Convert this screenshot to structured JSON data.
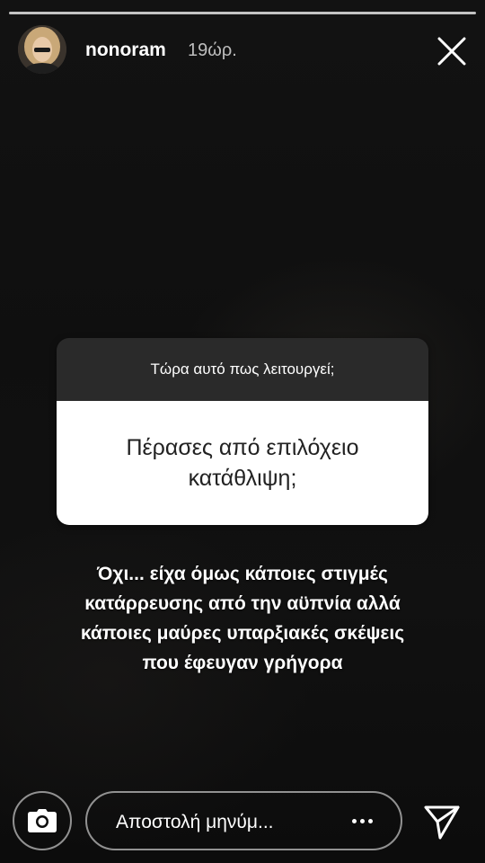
{
  "header": {
    "username": "nonoram",
    "time": "19ώρ."
  },
  "question": {
    "title": "Τώρα αυτό πως λειτουργεί;",
    "text": "Πέρασες από επιλόχειο κατάθλιψη;"
  },
  "answer": {
    "lines": [
      "Όχι... είχα όμως κάποιες στιγμές",
      "κατάρρευσης από την αϋπνία αλλά",
      "κάποιες μαύρες υπαρξιακές σκέψεις",
      "που έφευγαν γρήγορα"
    ]
  },
  "composer": {
    "placeholder": "Αποστολή μηνύμ..."
  },
  "icons": {
    "close": "close-icon",
    "camera": "camera-icon",
    "more": "more-dots-icon",
    "send": "send-icon"
  }
}
